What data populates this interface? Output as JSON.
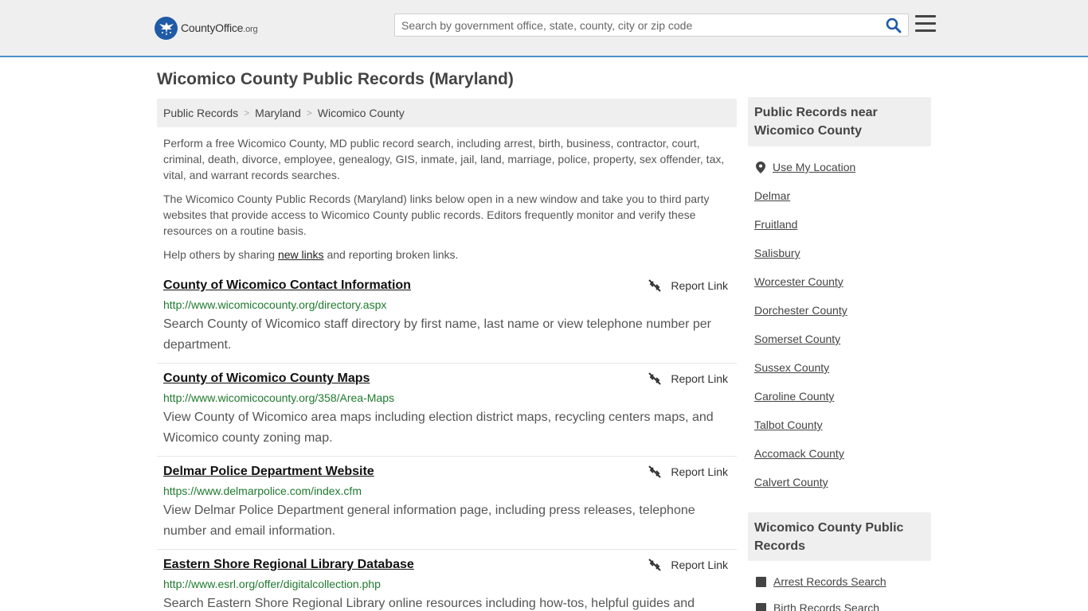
{
  "header": {
    "logo_text": "CountyOffice",
    "logo_tld": ".org",
    "search_placeholder": "Search by government office, state, county, city or zip code"
  },
  "page_title": "Wicomico County Public Records (Maryland)",
  "breadcrumb": [
    "Public Records",
    "Maryland",
    "Wicomico County"
  ],
  "intro": {
    "p1": "Perform a free Wicomico County, MD public record search, including arrest, birth, business, contractor, court, criminal, death, divorce, employee, genealogy, GIS, inmate, jail, land, marriage, police, property, sex offender, tax, vital, and warrant records searches.",
    "p2": "The Wicomico County Public Records (Maryland) links below open in a new window and take you to third party websites that provide access to Wicomico County public records. Editors frequently monitor and verify these resources on a routine basis.",
    "p3_before": "Help others by sharing ",
    "p3_link": "new links",
    "p3_after": " and reporting broken links."
  },
  "report_label": "Report Link",
  "records": [
    {
      "title": "County of Wicomico Contact Information",
      "url": "http://www.wicomicocounty.org/directory.aspx",
      "desc": "Search County of Wicomico staff directory by first name, last name or view telephone number per department."
    },
    {
      "title": "County of Wicomico County Maps",
      "url": "http://www.wicomicocounty.org/358/Area-Maps",
      "desc": "View County of Wicomico area maps including election district maps, recycling centers maps, and Wicomico county zoning map."
    },
    {
      "title": "Delmar Police Department Website",
      "url": "https://www.delmarpolice.com/index.cfm",
      "desc": "View Delmar Police Department general information page, including press releases, telephone number and email information."
    },
    {
      "title": "Eastern Shore Regional Library Database",
      "url": "http://www.esrl.org/offer/digitalcollection.php",
      "desc": "Search Eastern Shore Regional Library online resources including how-tos, helpful guides and"
    }
  ],
  "sidebar": {
    "near_heading": "Public Records near Wicomico County",
    "use_location": "Use My Location",
    "near_links": [
      "Delmar",
      "Fruitland",
      "Salisbury",
      "Worcester County",
      "Dorchester County",
      "Somerset County",
      "Sussex County",
      "Caroline County",
      "Talbot County",
      "Accomack County",
      "Calvert County"
    ],
    "records_heading": "Wicomico County Public Records",
    "record_links": [
      "Arrest Records Search",
      "Birth Records Search"
    ]
  },
  "colors": {
    "accent": "#4a90c8",
    "url_green": "#1f7a2e",
    "logo_blue": "#1f5aa6"
  }
}
